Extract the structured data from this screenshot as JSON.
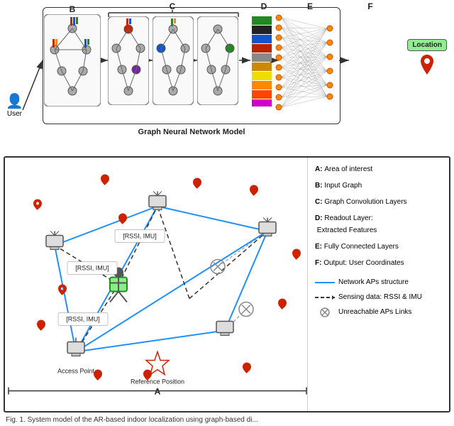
{
  "labels": {
    "A": "A",
    "B": "B",
    "C": "C",
    "D": "D",
    "E": "E",
    "F": "F",
    "user": "User",
    "gnn_model": "Graph Neural Network Model",
    "location": "Location",
    "access_point": "Access Point",
    "reference_position": "Reference Position",
    "area_label": "A"
  },
  "legend": [
    {
      "key": "A:",
      "text": "Area of interest"
    },
    {
      "key": "B:",
      "text": "Input Graph"
    },
    {
      "key": "C:",
      "text": "Graph Convolution Layers"
    },
    {
      "key": "D:",
      "text": "Readout Layer:\n  Extracted Features"
    },
    {
      "key": "E:",
      "text": "Fully Connected Layers"
    },
    {
      "key": "F:",
      "text": "Output: User Coordinates"
    }
  ],
  "legend_lines": [
    {
      "color": "#1e90ff",
      "label": "Network APs structure"
    },
    {
      "color": "#000",
      "label": "Sensing data: RSSI & IMU",
      "dashed": true
    },
    {
      "color": "#888",
      "label": "Unreachable APs Links"
    }
  ],
  "caption": "Fig. 1. System model of the AR-based indoor localization using graph-based di...",
  "edge_labels": [
    "[RSSI, IMU]",
    "[RSSI, IMU]",
    "[RSSI, IMU]"
  ],
  "colors": {
    "blue_line": "#1e90ff",
    "dark": "#222",
    "gnn_border": "#333",
    "node_gray": "#aaa",
    "node_red": "#cc2200",
    "node_blue": "#1155cc",
    "node_green": "#228822",
    "node_purple": "#7722aa"
  }
}
